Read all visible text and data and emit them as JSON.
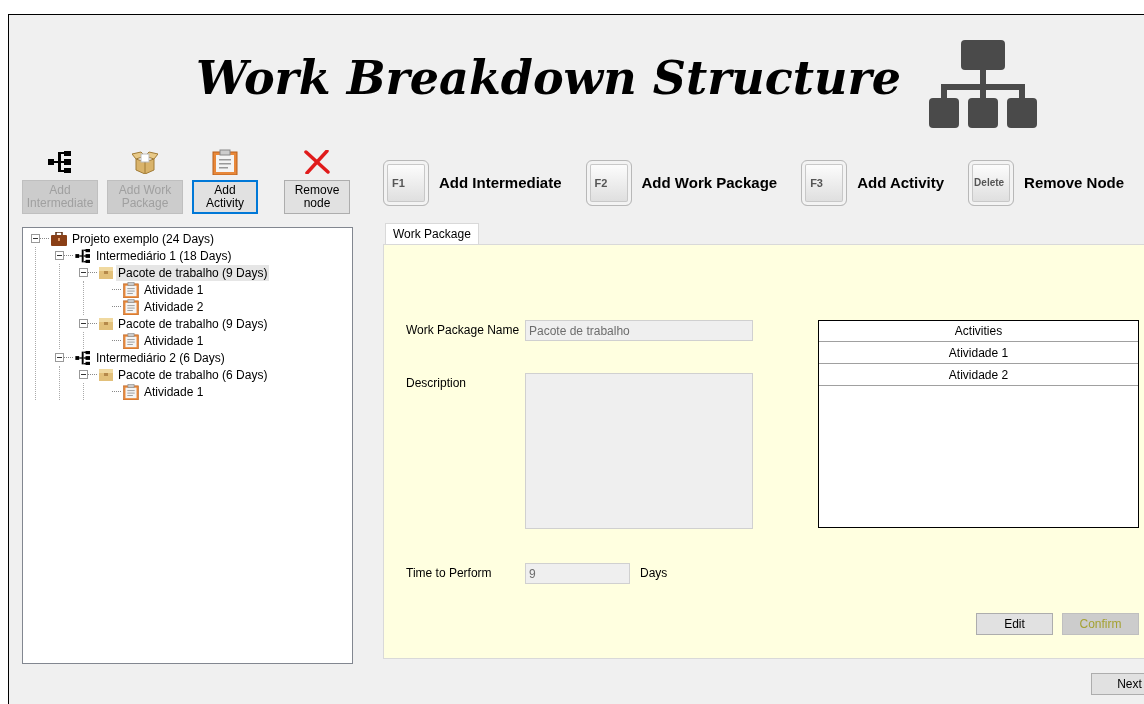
{
  "title": "Work Breakdown Structure",
  "toolbar": [
    {
      "label": "Add Intermediate",
      "kind": "intermediate",
      "disabled": true,
      "focused": false
    },
    {
      "label": "Add Work Package",
      "kind": "package",
      "disabled": true,
      "focused": false
    },
    {
      "label": "Add Activity",
      "kind": "activity",
      "disabled": false,
      "focused": true
    },
    {
      "label": "Remove node",
      "kind": "remove",
      "disabled": false,
      "focused": false
    }
  ],
  "shortcuts": [
    {
      "key": "F1",
      "action": "Add Intermediate"
    },
    {
      "key": "F2",
      "action": "Add Work Package"
    },
    {
      "key": "F3",
      "action": "Add Activity"
    },
    {
      "key": "Delete",
      "action": "Remove Node"
    }
  ],
  "tree": [
    {
      "kind": "project",
      "label": "Projeto exemplo (24 Days)",
      "expanded": true,
      "selected": false,
      "children": [
        {
          "kind": "intermediate",
          "label": "Intermediário 1 (18 Days)",
          "expanded": true,
          "selected": false,
          "children": [
            {
              "kind": "package",
              "label": "Pacote de trabalho (9 Days)",
              "expanded": true,
              "selected": true,
              "children": [
                {
                  "kind": "activity",
                  "label": "Atividade 1",
                  "selected": false
                },
                {
                  "kind": "activity",
                  "label": "Atividade 2",
                  "selected": false
                }
              ]
            },
            {
              "kind": "package",
              "label": "Pacote de trabalho (9 Days)",
              "expanded": true,
              "selected": false,
              "children": [
                {
                  "kind": "activity",
                  "label": "Atividade 1",
                  "selected": false
                }
              ]
            }
          ]
        },
        {
          "kind": "intermediate",
          "label": "Intermediário 2 (6 Days)",
          "expanded": true,
          "selected": false,
          "children": [
            {
              "kind": "package",
              "label": "Pacote de trabalho (6 Days)",
              "expanded": true,
              "selected": false,
              "children": [
                {
                  "kind": "activity",
                  "label": "Atividade 1",
                  "selected": false
                }
              ]
            }
          ]
        }
      ]
    }
  ],
  "tabs": [
    {
      "label": "Work Package",
      "selected": true
    }
  ],
  "fields": [
    {
      "kind": "text",
      "label": "Work Package Name",
      "value": "Pacote de trabalho",
      "disabled": true
    },
    {
      "kind": "textarea",
      "label": "Description",
      "disabled": true
    },
    {
      "kind": "number",
      "label": "Time to Perform",
      "value": "9",
      "unit": "Days",
      "disabled": true
    }
  ],
  "activities": {
    "header": "Activities",
    "rows": [
      "Atividade 1",
      "Atividade 2"
    ]
  },
  "form_buttons": [
    {
      "label": "Edit",
      "disabled": false
    },
    {
      "label": "Confirm",
      "disabled": true
    }
  ],
  "next_button": {
    "label": "Next"
  }
}
